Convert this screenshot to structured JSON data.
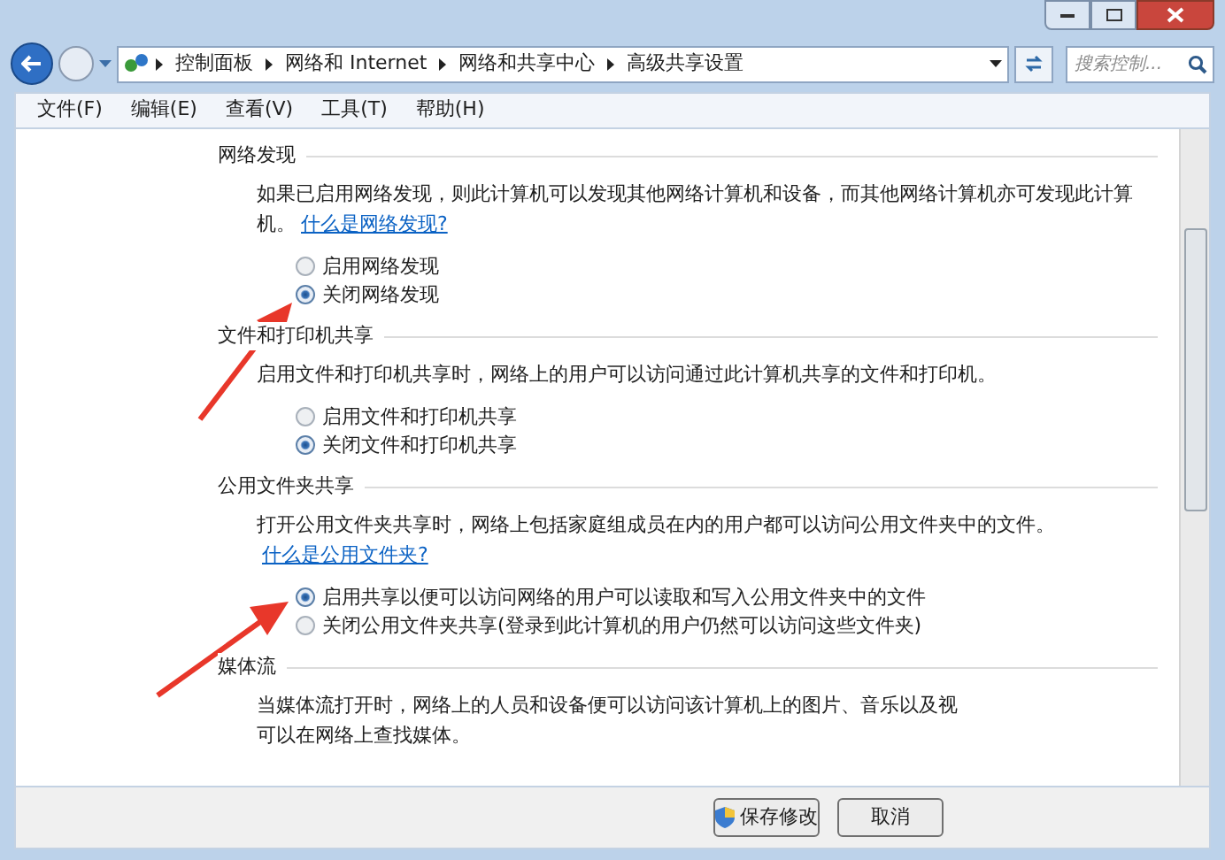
{
  "address_bar": {
    "breadcrumbs": [
      "控制面板",
      "网络和 Internet",
      "网络和共享中心",
      "高级共享设置"
    ],
    "search": {
      "placeholder": "搜索控制..."
    }
  },
  "menu": [
    "文件(F)",
    "编辑(E)",
    "查看(V)",
    "工具(T)",
    "帮助(H)"
  ],
  "sections": [
    {
      "title": "网络发现",
      "description": "如果已启用网络发现，则此计算机可以发现其他网络计算机和设备，而其他网络计算机亦可发现此计算机。",
      "link": "什么是网络发现?",
      "options": [
        {
          "label": "启用网络发现",
          "selected": false
        },
        {
          "label": "关闭网络发现",
          "selected": true
        }
      ]
    },
    {
      "title": "文件和打印机共享",
      "description": "启用文件和打印机共享时，网络上的用户可以访问通过此计算机共享的文件和打印机。",
      "options": [
        {
          "label": "启用文件和打印机共享",
          "selected": false
        },
        {
          "label": "关闭文件和打印机共享",
          "selected": true
        }
      ]
    },
    {
      "title": "公用文件夹共享",
      "description": "打开公用文件夹共享时，网络上包括家庭组成员在内的用户都可以访问公用文件夹中的文件。",
      "link": "什么是公用文件夹?",
      "options": [
        {
          "label": "启用共享以便可以访问网络的用户可以读取和写入公用文件夹中的文件",
          "selected": true
        },
        {
          "label": "关闭公用文件夹共享(登录到此计算机的用户仍然可以访问这些文件夹)",
          "selected": false
        }
      ]
    },
    {
      "title": "媒体流",
      "lines": [
        "当媒体流打开时，网络上的人员和设备便可以访问该计算机上的图片、音乐以及视",
        "可以在网络上查找媒体。"
      ]
    }
  ],
  "buttons": [
    "保存修改",
    "取消"
  ]
}
